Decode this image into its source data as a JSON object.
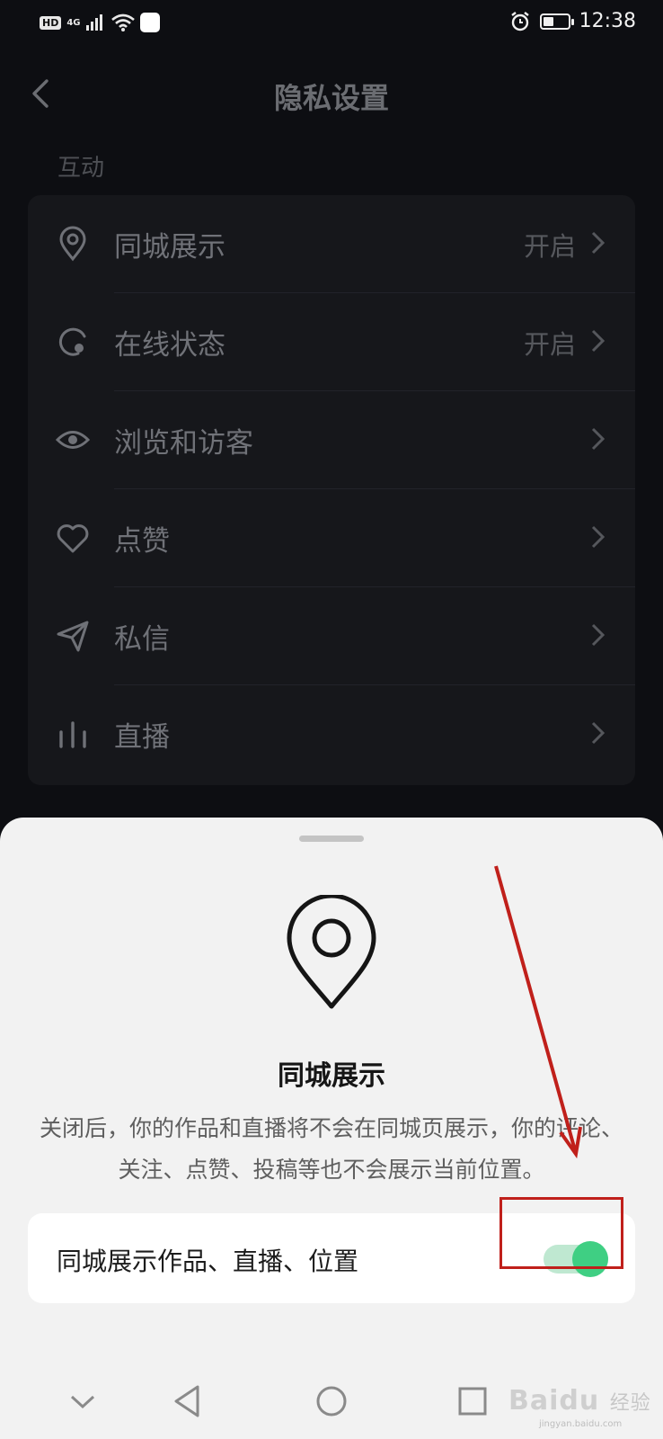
{
  "status_bar": {
    "hd": "HD",
    "network": "4G",
    "time": "12:38"
  },
  "header": {
    "title": "隐私设置"
  },
  "section": {
    "label": "互动"
  },
  "rows": [
    {
      "label": "同城展示",
      "value": "开启",
      "icon": "location-pin-icon"
    },
    {
      "label": "在线状态",
      "value": "开启",
      "icon": "online-status-icon"
    },
    {
      "label": "浏览和访客",
      "value": "",
      "icon": "eye-icon"
    },
    {
      "label": "点赞",
      "value": "",
      "icon": "heart-icon"
    },
    {
      "label": "私信",
      "value": "",
      "icon": "send-icon"
    },
    {
      "label": "直播",
      "value": "",
      "icon": "live-bars-icon"
    }
  ],
  "sheet": {
    "title": "同城展示",
    "description": "关闭后，你的作品和直播将不会在同城页展示，你的评论、关注、点赞、投稿等也不会展示当前位置。",
    "toggle_label": "同城展示作品、直播、位置",
    "toggle_on": true,
    "accent_color": "#3fcf83",
    "highlight_color": "#c0201b"
  },
  "watermark": {
    "brand": "Bai",
    "brand2": "du",
    "suffix": "经验",
    "url": "jingyan.baidu.com"
  }
}
